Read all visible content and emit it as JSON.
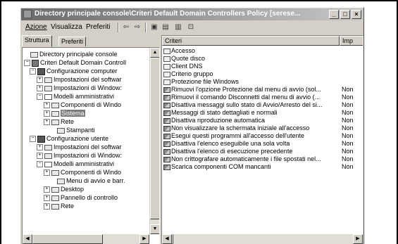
{
  "window": {
    "title": "Directory principale console\\Criteri Default Domain Controllers Policy [serese...",
    "controls": {
      "minimize": "_",
      "maximize": "□",
      "close": "×"
    }
  },
  "menu": {
    "items": [
      "Azione",
      "Visualizza",
      "Preferiti"
    ],
    "toolbar": [
      "back-arrow-icon",
      "forward-arrow-icon",
      "up-folder-icon",
      "show-hide-tree-icon",
      "export-list-icon",
      "help-icon"
    ]
  },
  "tabs": [
    {
      "label": "Struttura",
      "active": true
    },
    {
      "label": "Preferiti",
      "active": false
    }
  ],
  "tree": [
    {
      "label": "Directory principale console",
      "expander": "",
      "icon": "folder"
    },
    {
      "label": "Criteri Default Domain Controll",
      "expander": "−",
      "icon": "gpo"
    },
    {
      "label": "Configurazione computer",
      "expander": "−",
      "icon": "computer"
    },
    {
      "label": "Impostazioni del softwar",
      "expander": "+",
      "icon": "folder"
    },
    {
      "label": "Impostazioni di Window:",
      "expander": "+",
      "icon": "folder"
    },
    {
      "label": "Modelli amministrativi",
      "expander": "−",
      "icon": "folder"
    },
    {
      "label": "Componenti di Windo",
      "expander": "+",
      "icon": "folder"
    },
    {
      "label": "Sistema",
      "expander": "+",
      "icon": "folder",
      "selected": true
    },
    {
      "label": "Rete",
      "expander": "+",
      "icon": "folder"
    },
    {
      "label": "Stampanti",
      "expander": "",
      "icon": "folder"
    },
    {
      "label": "Configurazione utente",
      "expander": "−",
      "icon": "computer"
    },
    {
      "label": "Impostazioni del softwar",
      "expander": "+",
      "icon": "folder"
    },
    {
      "label": "Impostazioni di Window:",
      "expander": "+",
      "icon": "folder"
    },
    {
      "label": "Modelli amministrativi",
      "expander": "−",
      "icon": "folder"
    },
    {
      "label": "Componenti di Windo",
      "expander": "+",
      "icon": "folder"
    },
    {
      "label": "Menu di avvio e barr.",
      "expander": "",
      "icon": "folder"
    },
    {
      "label": "Desktop",
      "expander": "+",
      "icon": "folder"
    },
    {
      "label": "Pannello di controllo",
      "expander": "+",
      "icon": "folder"
    },
    {
      "label": "Rete",
      "expander": "+",
      "icon": "folder"
    }
  ],
  "list": {
    "columns": [
      "Criteri",
      "Imp"
    ],
    "rows": [
      {
        "name": "Accesso",
        "icon": "folder",
        "state": ""
      },
      {
        "name": "Quote disco",
        "icon": "folder",
        "state": ""
      },
      {
        "name": "Client DNS",
        "icon": "folder",
        "state": ""
      },
      {
        "name": "Criterio gruppo",
        "icon": "folder",
        "state": ""
      },
      {
        "name": "Protezione file Windows",
        "icon": "folder",
        "state": ""
      },
      {
        "name": "Rimuovi l'opzione Protezione dal menu di avvio (sol...",
        "icon": "policy",
        "state": "Non"
      },
      {
        "name": "Rimuovi il comando Disconnetti dal menu di avvio (...",
        "icon": "policy",
        "state": "Non"
      },
      {
        "name": "Disattiva messaggi sullo stato di Avvio/Arresto del si...",
        "icon": "policy",
        "state": "Non"
      },
      {
        "name": "Messaggi di stato dettagliati e normali",
        "icon": "policy",
        "state": "Non"
      },
      {
        "name": "Disattiva riproduzione automatica",
        "icon": "policy",
        "state": "Non"
      },
      {
        "name": "Non visualizzare la schermata iniziale all'accesso",
        "icon": "policy",
        "state": "Non"
      },
      {
        "name": "Esegui questi programmi all'accesso dell'utente",
        "icon": "policy",
        "state": "Non"
      },
      {
        "name": "Disattiva l'elenco eseguibile una sola volta",
        "icon": "policy",
        "state": "Non"
      },
      {
        "name": "Disattiva l'elenco di esecuzione precedente",
        "icon": "policy",
        "state": "Non"
      },
      {
        "name": "Non crittografare automaticamente i file spostati nel...",
        "icon": "policy",
        "state": "Non"
      },
      {
        "name": "Scarica componenti COM mancanti",
        "icon": "policy",
        "state": "Non"
      }
    ]
  }
}
